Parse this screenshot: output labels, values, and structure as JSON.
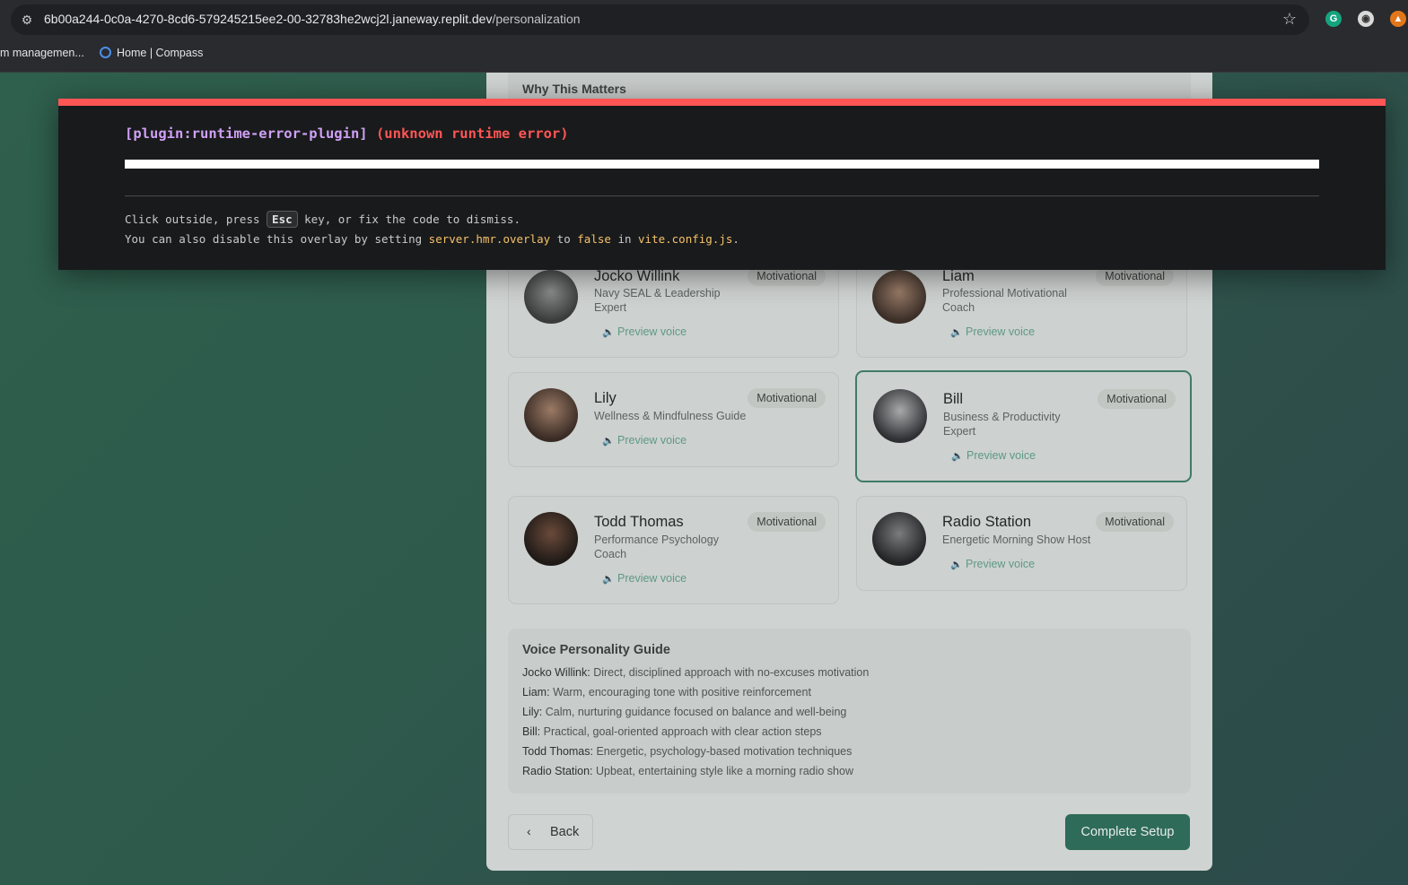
{
  "browser": {
    "url_host": "6b00a244-0c0a-4270-8cd6-579245215ee2-00-32783he2wcj2l.janeway.replit.dev",
    "url_path": "/personalization",
    "bookmarks": [
      "m managemen...",
      "Home | Compass"
    ]
  },
  "page": {
    "why_title": "Why This Matters",
    "voices": [
      {
        "name": "Jocko Willink",
        "desc": "Navy SEAL & Leadership Expert",
        "badge": "Motivational",
        "preview": "Preview voice"
      },
      {
        "name": "Liam",
        "desc": "Professional Motivational Coach",
        "badge": "Motivational",
        "preview": "Preview voice"
      },
      {
        "name": "Lily",
        "desc": "Wellness & Mindfulness Guide",
        "badge": "Motivational",
        "preview": "Preview voice"
      },
      {
        "name": "Bill",
        "desc": "Business & Productivity Expert",
        "badge": "Motivational",
        "preview": "Preview voice"
      },
      {
        "name": "Todd Thomas",
        "desc": "Performance Psychology Coach",
        "badge": "Motivational",
        "preview": "Preview voice"
      },
      {
        "name": "Radio Station",
        "desc": "Energetic Morning Show Host",
        "badge": "Motivational",
        "preview": "Preview voice"
      }
    ],
    "guide": {
      "title": "Voice Personality Guide",
      "lines": [
        {
          "name": "Jocko Willink:",
          "text": "Direct, disciplined approach with no-excuses motivation"
        },
        {
          "name": "Liam:",
          "text": "Warm, encouraging tone with positive reinforcement"
        },
        {
          "name": "Lily:",
          "text": "Calm, nurturing guidance focused on balance and well-being"
        },
        {
          "name": "Bill:",
          "text": "Practical, goal-oriented approach with clear action steps"
        },
        {
          "name": "Todd Thomas:",
          "text": "Energetic, psychology-based motivation techniques"
        },
        {
          "name": "Radio Station:",
          "text": "Upbeat, entertaining style like a morning radio show"
        }
      ]
    },
    "back_label": "Back",
    "complete_label": "Complete Setup"
  },
  "error_overlay": {
    "plugin": "[plugin:runtime-error-plugin]",
    "message": "(unknown runtime error)",
    "tip1_a": "Click outside, press",
    "tip1_key": "Esc",
    "tip1_b": "key, or fix the code to dismiss.",
    "tip2_a": "You can also disable this overlay by setting",
    "tip2_code1": "server.hmr.overlay",
    "tip2_b": "to",
    "tip2_code2": "false",
    "tip2_c": "in",
    "tip2_code3": "vite.config.js",
    "tip2_d": "."
  },
  "colors": {
    "accent": "#2f6b59",
    "error": "#ff5555",
    "plugin": "#cfa0f5",
    "code": "#f5c26b"
  }
}
